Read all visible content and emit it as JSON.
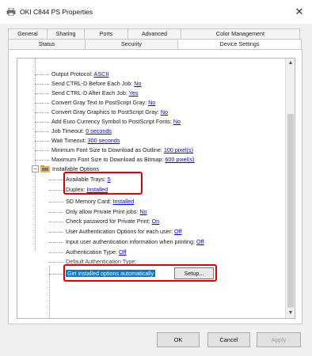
{
  "window": {
    "title": "OKI C844 PS Properties",
    "close_symbol": "✕"
  },
  "tabs_row1": [
    "General",
    "Sharing",
    "Ports",
    "Advanced",
    "Color Management"
  ],
  "tabs_row2": [
    "Status",
    "Security",
    "Device Settings"
  ],
  "active_tab": "Device Settings",
  "tree": {
    "items": [
      {
        "label": "Output Protocol:",
        "value": "ASCII"
      },
      {
        "label": "Send CTRL-D Before Each Job:",
        "value": "No"
      },
      {
        "label": "Send CTRL-D After Each Job:",
        "value": "Yes"
      },
      {
        "label": "Convert Gray Text to PostScript Gray:",
        "value": "No"
      },
      {
        "label": "Convert Gray Graphics to PostScript Gray:",
        "value": "No"
      },
      {
        "label": "Add Euro Currency Symbol to PostScript Fonts:",
        "value": "No"
      },
      {
        "label": "Job Timeout:",
        "value": "0 seconds"
      },
      {
        "label": "Wait Timeout:",
        "value": "300 seconds"
      },
      {
        "label": "Minimum Font Size to Download as Outline:",
        "value": "100 pixel(s)"
      },
      {
        "label": "Maximum Font Size to Download as Bitmap:",
        "value": "600 pixel(s)"
      }
    ],
    "installable_options_label": "Installable Options",
    "options": [
      {
        "label": "Available Trays:",
        "value": "5"
      },
      {
        "label": "Duplex:",
        "value": "Installed"
      },
      {
        "label": "SD Memory Card:",
        "value": "Installed"
      },
      {
        "label": "Only allow Private Print jobs:",
        "value": "No"
      },
      {
        "label": "Check password for Private Print:",
        "value": "On"
      },
      {
        "label": "User Authentication Options for each user:",
        "value": "Off"
      },
      {
        "label": "Input user authentication information when printing:",
        "value": "Off"
      },
      {
        "label": "Authentication Type:",
        "value": "Off"
      },
      {
        "label": "Default Authentication Type:",
        "value": ""
      }
    ],
    "get_options_label": "Get installed options automatically",
    "setup_label": "Setup..."
  },
  "buttons": {
    "ok": "OK",
    "cancel": "Cancel",
    "apply": "Apply"
  },
  "colors": {
    "highlight": "#e00000",
    "selection": "#0078d7",
    "link": "#0000ee"
  }
}
